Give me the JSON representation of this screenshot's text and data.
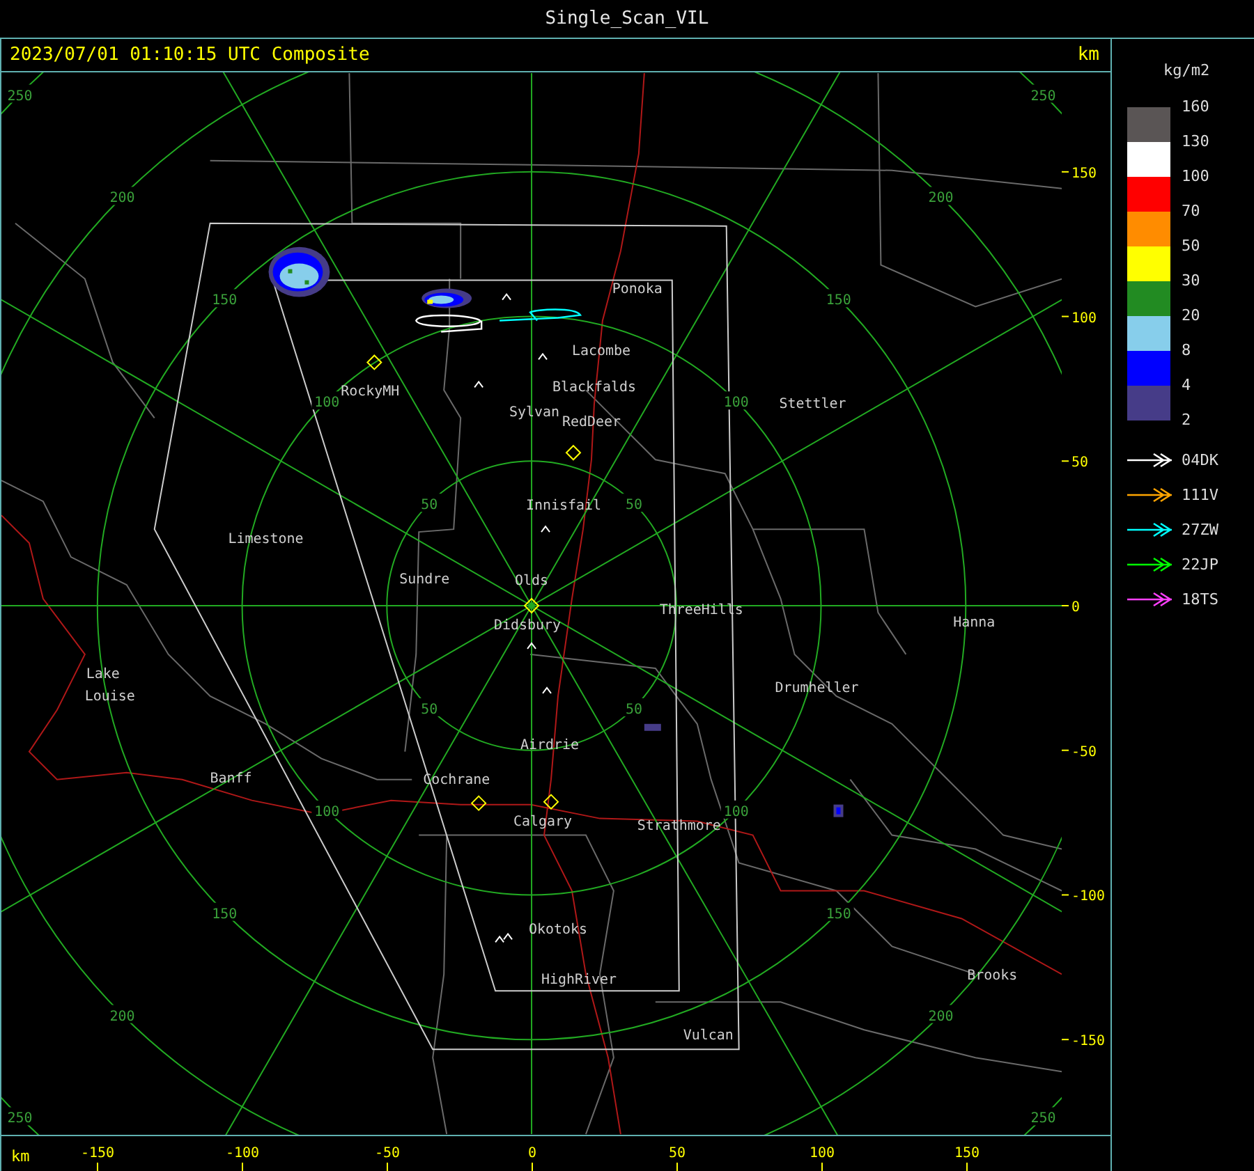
{
  "window": {
    "title": "Single_Scan_VIL"
  },
  "header": {
    "timestamp": "2023/07/01 01:10:15 UTC Composite",
    "unit": "km"
  },
  "map": {
    "range_rings": [
      {
        "labels": [
          "50",
          "50",
          "50",
          "50"
        ]
      },
      {
        "labels": [
          "100",
          "100",
          "100",
          "100"
        ]
      },
      {
        "labels": [
          "150",
          "150",
          "150",
          "150"
        ]
      },
      {
        "labels": [
          "200",
          "200",
          "200",
          "200"
        ]
      },
      {
        "labels": [
          "250",
          "250",
          "250",
          "250"
        ]
      }
    ],
    "places": [
      "Ponoka",
      "Lacombe",
      "Blackfalds",
      "Sylvan",
      "RedDeer",
      "RockyMH",
      "Stettler",
      "Innisfail",
      "Limestone",
      "Sundre",
      "Olds",
      "Didsbury",
      "ThreeHills",
      "Hanna",
      "Lake",
      "Louise",
      "Drumheller",
      "Airdrie",
      "Banff",
      "Cochrane",
      "Calgary",
      "Strathmore",
      "Okotoks",
      "HighRiver",
      "Brooks",
      "Vulcan"
    ]
  },
  "y_axis": {
    "ticks": [
      "150",
      "100",
      "50",
      "0",
      "-50",
      "-100",
      "-150"
    ]
  },
  "x_axis": {
    "unit": "km",
    "ticks": [
      "-150",
      "-100",
      "-50",
      "0",
      "50",
      "100",
      "150"
    ]
  },
  "legend": {
    "unit": "kg/m2",
    "scale_colors": [
      {
        "color": "#5a5555"
      },
      {
        "color": "#ffffff"
      },
      {
        "color": "#ff0000"
      },
      {
        "color": "#ff8c00"
      },
      {
        "color": "#ffff00"
      },
      {
        "color": "#228b22"
      },
      {
        "color": "#87ceeb"
      },
      {
        "color": "#0000ff"
      },
      {
        "color": "#463c88"
      }
    ],
    "scale_labels": [
      "160",
      "130",
      "100",
      "70",
      "50",
      "30",
      "20",
      "8",
      "4",
      "2"
    ],
    "tracks": [
      {
        "label": "04DK",
        "color": "#ffffff"
      },
      {
        "label": "111V",
        "color": "#ffa500"
      },
      {
        "label": "27ZW",
        "color": "#00ffff"
      },
      {
        "label": "22JP",
        "color": "#00ff00"
      },
      {
        "label": "18TS",
        "color": "#ff40ff"
      }
    ]
  }
}
